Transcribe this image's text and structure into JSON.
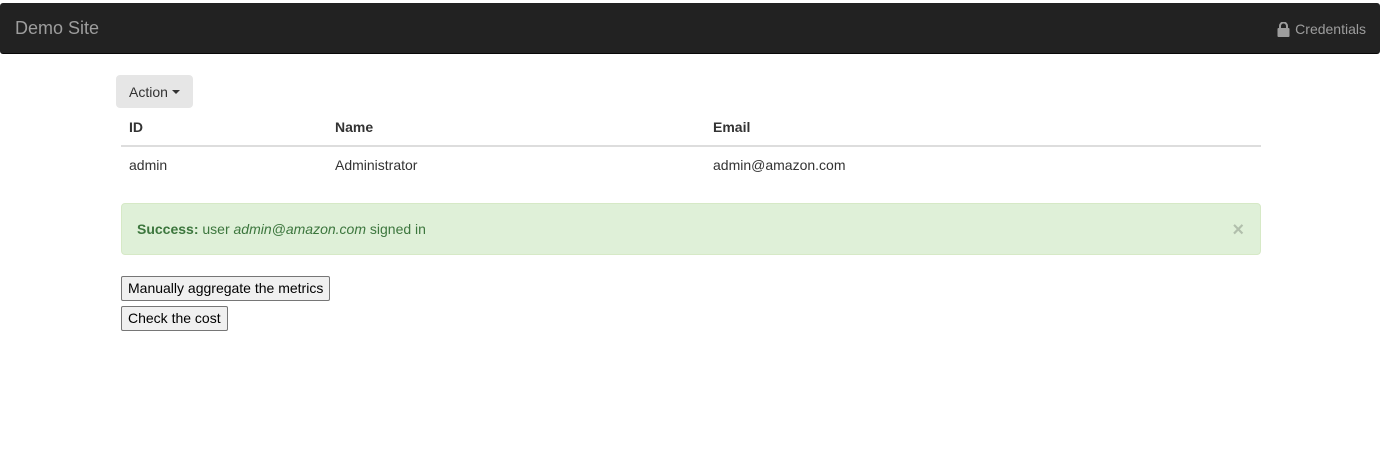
{
  "navbar": {
    "brand": "Demo Site",
    "credentials_label": "Credentials",
    "credentials_icon": "lock-icon",
    "background": "#222222"
  },
  "action_menu": {
    "label": "Action"
  },
  "table": {
    "headers": [
      "ID",
      "Name",
      "Email"
    ],
    "rows": [
      [
        "admin",
        "Administrator",
        "admin@amazon.com"
      ]
    ]
  },
  "alert": {
    "type": "success",
    "prefix": "Success:",
    "text_before": " user ",
    "email": "admin@amazon.com",
    "text_after": " signed in",
    "close_glyph": "×",
    "background": "#dff0d8",
    "text_color": "#3c763d"
  },
  "buttons": {
    "aggregate_label": "Manually aggregate the metrics",
    "cost_label": "Check the cost"
  }
}
